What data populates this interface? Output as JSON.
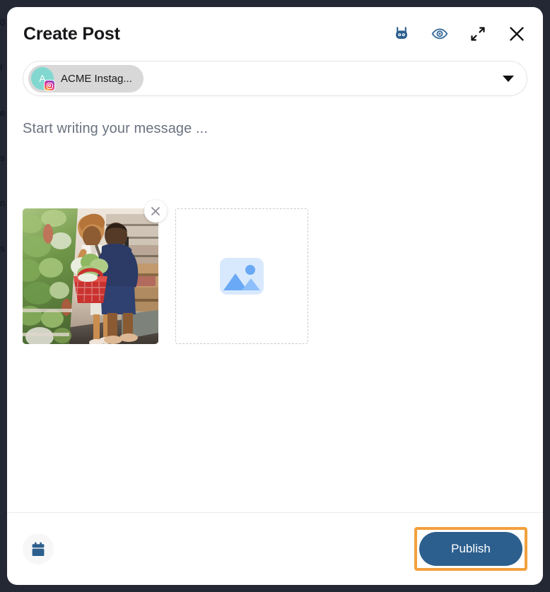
{
  "window": {
    "background_color": "#232834",
    "modal_background": "#ffffff"
  },
  "header": {
    "title": "Create Post",
    "actions": [
      {
        "name": "bot-icon",
        "label": "AI Assistant",
        "color": "#2c5f8e"
      },
      {
        "name": "eye-icon",
        "label": "Preview",
        "color": "#3a6d9c"
      },
      {
        "name": "expand-icon",
        "label": "Expand",
        "color": "#111111"
      },
      {
        "name": "close-icon",
        "label": "Close",
        "color": "#111111"
      }
    ]
  },
  "account_select": {
    "chip_label": "ACME Instag...",
    "avatar_letter": "A",
    "avatar_color": "#82d8d0",
    "network": "instagram",
    "caret": "▼"
  },
  "composer": {
    "placeholder": "Start writing your message ...",
    "value": ""
  },
  "media": {
    "attached": [
      {
        "alt": "Two shoppers choosing greens in a grocery store produce aisle with a red basket",
        "remove_label": "×"
      }
    ],
    "placeholder": {
      "icon": "image-placeholder-icon",
      "icon_bg": "#d9e9fd",
      "icon_fg": "#69a9f5"
    }
  },
  "footer": {
    "schedule_icon": "calendar-icon",
    "publish_label": "Publish",
    "publish_color": "#2c5f8e",
    "highlight_color": "#f2a03d"
  },
  "background_bleed": [
    "0",
    "I",
    "e",
    "s",
    "n",
    "s"
  ]
}
